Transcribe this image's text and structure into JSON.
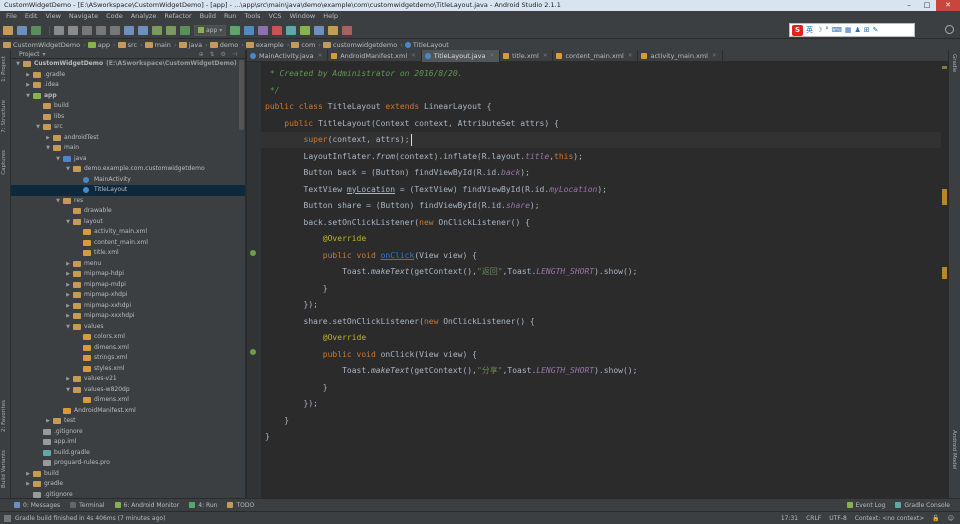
{
  "window": {
    "title": "CustomWidgetDemo - [E:\\ASworkspace\\CustomWidgetDemo] - [app] - ...\\app\\src\\main\\java\\demo\\example\\com\\customwidgetdemo\\TitleLayout.java - Android Studio 2.1.1"
  },
  "menu": [
    "File",
    "Edit",
    "View",
    "Navigate",
    "Code",
    "Analyze",
    "Refactor",
    "Build",
    "Run",
    "Tools",
    "VCS",
    "Window",
    "Help"
  ],
  "toolbar": {
    "run_config": "app"
  },
  "ime": {
    "logo": "S",
    "label": "英"
  },
  "breadcrumb": [
    "CustomWidgetDemo",
    "app",
    "src",
    "main",
    "java",
    "demo",
    "example",
    "com",
    "customwidgetdemo",
    "TitleLayout"
  ],
  "project": {
    "header": "Project",
    "tree": [
      {
        "label": "CustomWidgetDemo",
        "path": "(E:\\ASworkspace\\CustomWidgetDemo)",
        "depth": 0,
        "open": true,
        "bold": true,
        "icon": "folder"
      },
      {
        "label": ".gradle",
        "depth": 1,
        "open": false,
        "icon": "folder"
      },
      {
        "label": ".idea",
        "depth": 1,
        "open": false,
        "icon": "folder"
      },
      {
        "label": "app",
        "depth": 1,
        "open": true,
        "bold": true,
        "icon": "module"
      },
      {
        "label": "build",
        "depth": 2,
        "leaf": true,
        "icon": "folder"
      },
      {
        "label": "libs",
        "depth": 2,
        "leaf": true,
        "icon": "folder"
      },
      {
        "label": "src",
        "depth": 2,
        "open": true,
        "icon": "folder"
      },
      {
        "label": "androidTest",
        "depth": 3,
        "open": false,
        "icon": "folder"
      },
      {
        "label": "main",
        "depth": 3,
        "open": true,
        "icon": "folder"
      },
      {
        "label": "java",
        "depth": 4,
        "open": true,
        "icon": "src"
      },
      {
        "label": "demo.example.com.customwidgetdemo",
        "depth": 5,
        "open": true,
        "icon": "package"
      },
      {
        "label": "MainActivity",
        "depth": 6,
        "leaf": true,
        "icon": "class"
      },
      {
        "label": "TitleLayout",
        "depth": 6,
        "leaf": true,
        "icon": "class",
        "selected": true
      },
      {
        "label": "res",
        "depth": 4,
        "open": true,
        "icon": "res"
      },
      {
        "label": "drawable",
        "depth": 5,
        "leaf": true,
        "icon": "folder"
      },
      {
        "label": "layout",
        "depth": 5,
        "open": true,
        "icon": "folder"
      },
      {
        "label": "activity_main.xml",
        "depth": 6,
        "leaf": true,
        "icon": "xml"
      },
      {
        "label": "content_main.xml",
        "depth": 6,
        "leaf": true,
        "icon": "xml"
      },
      {
        "label": "title.xml",
        "depth": 6,
        "leaf": true,
        "icon": "xml"
      },
      {
        "label": "menu",
        "depth": 5,
        "open": false,
        "icon": "folder"
      },
      {
        "label": "mipmap-hdpi",
        "depth": 5,
        "open": false,
        "icon": "folder"
      },
      {
        "label": "mipmap-mdpi",
        "depth": 5,
        "open": false,
        "icon": "folder"
      },
      {
        "label": "mipmap-xhdpi",
        "depth": 5,
        "open": false,
        "icon": "folder"
      },
      {
        "label": "mipmap-xxhdpi",
        "depth": 5,
        "open": false,
        "icon": "folder"
      },
      {
        "label": "mipmap-xxxhdpi",
        "depth": 5,
        "open": false,
        "icon": "folder"
      },
      {
        "label": "values",
        "depth": 5,
        "open": true,
        "icon": "folder"
      },
      {
        "label": "colors.xml",
        "depth": 6,
        "leaf": true,
        "icon": "xml"
      },
      {
        "label": "dimens.xml",
        "depth": 6,
        "leaf": true,
        "icon": "xml"
      },
      {
        "label": "strings.xml",
        "depth": 6,
        "leaf": true,
        "icon": "xml"
      },
      {
        "label": "styles.xml",
        "depth": 6,
        "leaf": true,
        "icon": "xml"
      },
      {
        "label": "values-v21",
        "depth": 5,
        "open": false,
        "icon": "folder"
      },
      {
        "label": "values-w820dp",
        "depth": 5,
        "open": true,
        "icon": "folder"
      },
      {
        "label": "dimens.xml",
        "depth": 6,
        "leaf": true,
        "icon": "xml"
      },
      {
        "label": "AndroidManifest.xml",
        "depth": 4,
        "leaf": true,
        "icon": "xml"
      },
      {
        "label": "test",
        "depth": 3,
        "open": false,
        "icon": "folder"
      },
      {
        "label": ".gitignore",
        "depth": 2,
        "leaf": true,
        "icon": "file"
      },
      {
        "label": "app.iml",
        "depth": 2,
        "leaf": true,
        "icon": "file"
      },
      {
        "label": "build.gradle",
        "depth": 2,
        "leaf": true,
        "icon": "gradle"
      },
      {
        "label": "proguard-rules.pro",
        "depth": 2,
        "leaf": true,
        "icon": "file"
      },
      {
        "label": "build",
        "depth": 1,
        "open": false,
        "icon": "folder"
      },
      {
        "label": "gradle",
        "depth": 1,
        "open": false,
        "icon": "folder"
      },
      {
        "label": ".gitignore",
        "depth": 1,
        "leaf": true,
        "icon": "file"
      }
    ]
  },
  "tool_windows_left": [
    "1: Project",
    "7: Structure",
    "Captures",
    "2: Favorites",
    "Build Variants"
  ],
  "tool_windows_right": [
    "Gradle",
    "Android Model"
  ],
  "tabs": [
    {
      "label": "MainActivity.java",
      "icon": "class"
    },
    {
      "label": "AndroidManifest.xml",
      "icon": "xml"
    },
    {
      "label": "TitleLayout.java",
      "icon": "class",
      "active": true
    },
    {
      "label": "title.xml",
      "icon": "xml"
    },
    {
      "label": "content_main.xml",
      "icon": "xml"
    },
    {
      "label": "activity_main.xml",
      "icon": "xml"
    }
  ],
  "code": [
    [
      [
        "cm",
        " * Created by Administrator on 2016/8/20."
      ]
    ],
    [
      [
        "cm",
        " */"
      ]
    ],
    [
      [
        "kw",
        "public class "
      ],
      [
        "",
        "TitleLayout "
      ],
      [
        "kw",
        "extends "
      ],
      [
        "",
        "LinearLayout {"
      ]
    ],
    [
      [
        "",
        "    "
      ],
      [
        "kw",
        "public "
      ],
      [
        "",
        "TitleLayout(Context context, AttributeSet attrs) {"
      ]
    ],
    [
      [
        "",
        "        "
      ],
      [
        "kw",
        "super"
      ],
      [
        "",
        "(context, attrs);"
      ]
    ],
    [
      [
        "",
        "        LayoutInflater."
      ],
      [
        "it",
        "from"
      ],
      [
        "",
        "(context).inflate(R.layout."
      ],
      [
        "fld",
        "title"
      ],
      [
        "",
        ","
      ],
      [
        "kw",
        "this"
      ],
      [
        "",
        ");"
      ]
    ],
    [
      [
        "",
        "        Button back = (Button) findViewById(R.id."
      ],
      [
        "fld",
        "back"
      ],
      [
        "",
        ");"
      ]
    ],
    [
      [
        "",
        "        TextView "
      ],
      [
        "un",
        "myLocation"
      ],
      [
        "",
        " = (TextView) findViewById(R.id."
      ],
      [
        "fld",
        "myLocation"
      ],
      [
        "",
        ");"
      ]
    ],
    [
      [
        "",
        "        Button share = (Button) findViewById(R.id."
      ],
      [
        "fld",
        "share"
      ],
      [
        "",
        ");"
      ]
    ],
    [
      [
        "",
        "        back.setOnClickListener("
      ],
      [
        "kw",
        "new "
      ],
      [
        "",
        "OnClickListener() {"
      ]
    ],
    [
      [
        "",
        "            "
      ],
      [
        "an",
        "@Override"
      ]
    ],
    [
      [
        "",
        "            "
      ],
      [
        "kw",
        "public void "
      ],
      [
        "lnk",
        "onClick"
      ],
      [
        "",
        "(View view) {"
      ]
    ],
    [
      [
        "",
        "                Toast."
      ],
      [
        "it",
        "makeText"
      ],
      [
        "",
        "(getContext(),"
      ],
      [
        "str",
        "\"返回\""
      ],
      [
        "",
        ",Toast."
      ],
      [
        "fld",
        "LENGTH_SHORT"
      ],
      [
        "",
        ").show();"
      ]
    ],
    [
      [
        "",
        "            }"
      ]
    ],
    [
      [
        "",
        "        });"
      ]
    ],
    [
      [
        "",
        "        share.setOnClickListener("
      ],
      [
        "kw",
        "new "
      ],
      [
        "",
        "OnClickListener() {"
      ]
    ],
    [
      [
        "",
        "            "
      ],
      [
        "an",
        "@Override"
      ]
    ],
    [
      [
        "",
        "            "
      ],
      [
        "kw",
        "public void "
      ],
      [
        "",
        "onClick(View view) {"
      ]
    ],
    [
      [
        "",
        "                Toast."
      ],
      [
        "it",
        "makeText"
      ],
      [
        "",
        "(getContext(),"
      ],
      [
        "str",
        "\"分享\""
      ],
      [
        "",
        ",Toast."
      ],
      [
        "fld",
        "LENGTH_SHORT"
      ],
      [
        "",
        ").show();"
      ]
    ],
    [
      [
        "",
        "            }"
      ]
    ],
    [
      [
        "",
        "        });"
      ]
    ],
    [
      [
        "",
        "    }"
      ]
    ],
    [
      [
        "",
        "}"
      ]
    ]
  ],
  "bottom_tools": [
    "0: Messages",
    "Terminal",
    "6: Android Monitor",
    "4: Run",
    "TODO"
  ],
  "bottom_tools_right": [
    "Event Log",
    "Gradle Console"
  ],
  "status": {
    "message": "Gradle build finished in 4s 406ms (7 minutes ago)",
    "position": "17:31",
    "line_sep": "CRLF",
    "encoding": "UTF-8",
    "context": "Context: <no context>"
  },
  "colors": {
    "keyword": "#cc7832",
    "comment": "#629755",
    "string": "#6a8759",
    "field": "#9876aa",
    "annotation": "#bbb529",
    "link": "#287bde",
    "text": "#a9b7c6"
  }
}
